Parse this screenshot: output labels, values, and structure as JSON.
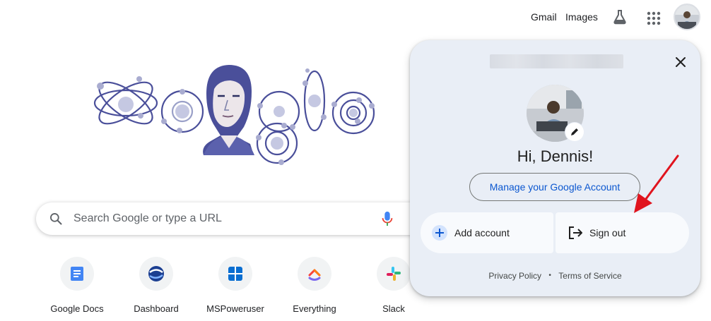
{
  "topbar": {
    "gmail_label": "Gmail",
    "images_label": "Images",
    "labs_icon": "flask-icon",
    "apps_icon": "apps-grid-icon"
  },
  "search": {
    "placeholder": "Search Google or type a URL"
  },
  "shortcuts": [
    {
      "label": "Google Docs",
      "icon": "google-docs-icon"
    },
    {
      "label": "Dashboard",
      "icon": "dashboard-icon"
    },
    {
      "label": "MSPoweruser",
      "icon": "mspoweruser-icon"
    },
    {
      "label": "Everything",
      "icon": "everything-icon"
    },
    {
      "label": "Slack",
      "icon": "slack-icon"
    }
  ],
  "account_popup": {
    "greeting": "Hi, Dennis!",
    "manage_label": "Manage your Google Account",
    "add_account_label": "Add account",
    "sign_out_label": "Sign out",
    "privacy_label": "Privacy Policy",
    "separator": "•",
    "terms_label": "Terms of Service"
  },
  "colors": {
    "popup_bg": "#e9eef6",
    "link_blue": "#0b57d0",
    "annotation_red": "#e0141e"
  }
}
